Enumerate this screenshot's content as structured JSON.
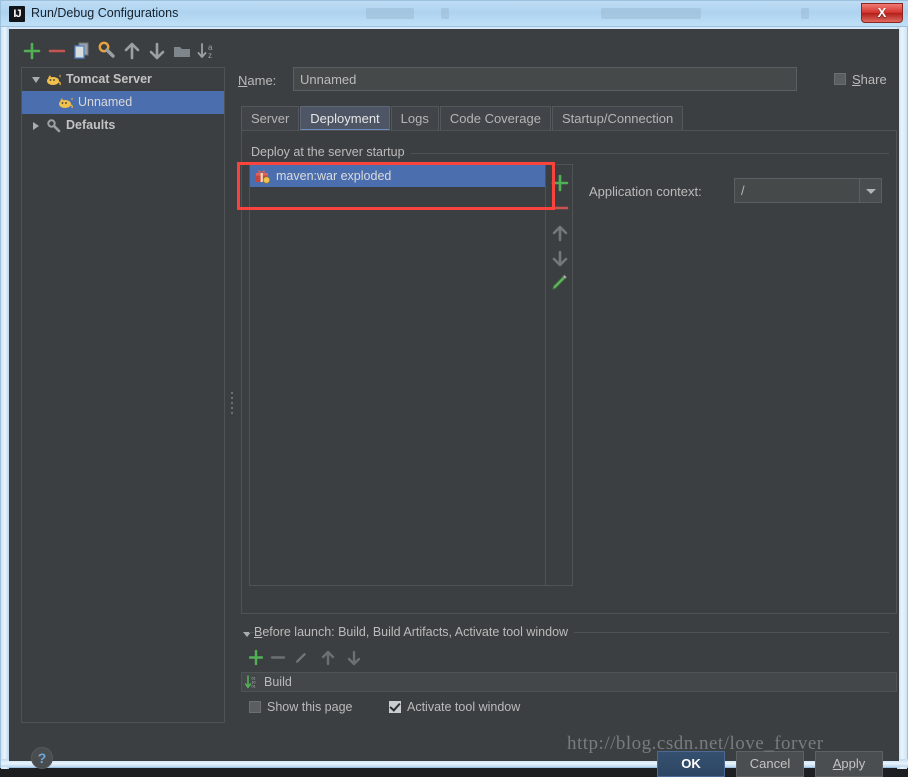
{
  "window": {
    "title": "Run/Debug Configurations",
    "app_icon": "intellij-idea-icon",
    "close_label": "X"
  },
  "left_toolbar": {
    "items": [
      {
        "name": "add-configuration-button",
        "icon": "plus-icon",
        "glyph": "+"
      },
      {
        "name": "remove-configuration-button",
        "icon": "minus-icon",
        "glyph": "−"
      },
      {
        "name": "copy-configuration-button",
        "icon": "copy-icon",
        "glyph": "❐"
      },
      {
        "name": "edit-defaults-button",
        "icon": "wrench-icon",
        "glyph": "⚙"
      },
      {
        "name": "move-up-button",
        "icon": "arrow-up-icon",
        "glyph": "↑"
      },
      {
        "name": "move-down-button",
        "icon": "arrow-down-icon",
        "glyph": "↓"
      },
      {
        "name": "new-folder-button",
        "icon": "folder-icon",
        "glyph": "▬"
      },
      {
        "name": "sort-configurations-button",
        "icon": "sort-alpha-icon",
        "glyph": "↓az"
      }
    ]
  },
  "tree": {
    "items": [
      {
        "label": "Tomcat Server",
        "icon": "tomcat-cat-icon",
        "expanded": true,
        "selected": false,
        "indent": 0,
        "bold": true
      },
      {
        "label": "Unnamed",
        "icon": "tomcat-cat-icon",
        "expanded": null,
        "selected": true,
        "indent": 1,
        "bold": false
      },
      {
        "label": "Defaults",
        "icon": "wrench-icon",
        "expanded": false,
        "selected": false,
        "indent": 0,
        "bold": true
      }
    ]
  },
  "help": {
    "label": "?"
  },
  "name_field": {
    "label": "Name:",
    "mnemonic": "N",
    "value": "Unnamed",
    "placeholder": ""
  },
  "share": {
    "label": "Share",
    "mnemonic": "S",
    "checked": false
  },
  "tabs": [
    {
      "label": "Server",
      "active": false
    },
    {
      "label": "Deployment",
      "active": true
    },
    {
      "label": "Logs",
      "active": false
    },
    {
      "label": "Code Coverage",
      "active": false
    },
    {
      "label": "Startup/Connection",
      "active": false
    }
  ],
  "deployment": {
    "group_title": "Deploy at the server startup",
    "artifacts": [
      {
        "label": "maven:war exploded",
        "icon": "artifact-icon",
        "selected": true
      }
    ],
    "side_buttons": [
      {
        "name": "add-artifact-button",
        "icon": "plus-icon",
        "glyph": "+",
        "enabled": true
      },
      {
        "name": "remove-artifact-button",
        "icon": "minus-icon",
        "glyph": "−",
        "enabled": true
      },
      {
        "name": "move-artifact-up-button",
        "icon": "arrow-up-icon",
        "glyph": "↑",
        "enabled": false
      },
      {
        "name": "move-artifact-down-button",
        "icon": "arrow-down-icon",
        "glyph": "↓",
        "enabled": false
      },
      {
        "name": "edit-artifact-button",
        "icon": "pencil-icon",
        "glyph": "✎",
        "enabled": true
      }
    ],
    "application_context": {
      "label": "Application context:",
      "value": "/",
      "placeholder": ""
    }
  },
  "before_launch": {
    "title": "Before launch: Build, Build Artifacts, Activate tool window",
    "mnemonic": "B",
    "expanded": true,
    "toolbar": [
      {
        "name": "add-task-button",
        "icon": "plus-icon",
        "glyph": "+",
        "enabled": true
      },
      {
        "name": "remove-task-button",
        "icon": "minus-icon",
        "glyph": "−",
        "enabled": false
      },
      {
        "name": "edit-task-button",
        "icon": "pencil-icon",
        "glyph": "✎",
        "enabled": false
      },
      {
        "name": "task-move-up-button",
        "icon": "arrow-up-icon",
        "glyph": "↑",
        "enabled": false
      },
      {
        "name": "task-move-down-button",
        "icon": "arrow-down-icon",
        "glyph": "↓",
        "enabled": false
      }
    ],
    "tasks": [
      {
        "label": "Build",
        "icon": "compile-icon"
      }
    ],
    "options": [
      {
        "label": "Show this page",
        "checked": false
      },
      {
        "label": "Activate tool window",
        "checked": true
      }
    ]
  },
  "footer": {
    "ok_label": "OK",
    "cancel_label": "Cancel",
    "apply_label": "Apply",
    "apply_mnemonic": "A"
  },
  "watermark": {
    "text": "http://blog.csdn.net/love_forver"
  },
  "colors": {
    "dialog_background": "#3c3f41",
    "selection_blue": "#4b6eaf",
    "accent_green": "#52b054",
    "accent_red": "#c75450",
    "annotation_red": "#f8443c",
    "tab_active": "#4e5564",
    "primary_button": "#2d4664",
    "titlebar_blue": "#aed3f0"
  }
}
